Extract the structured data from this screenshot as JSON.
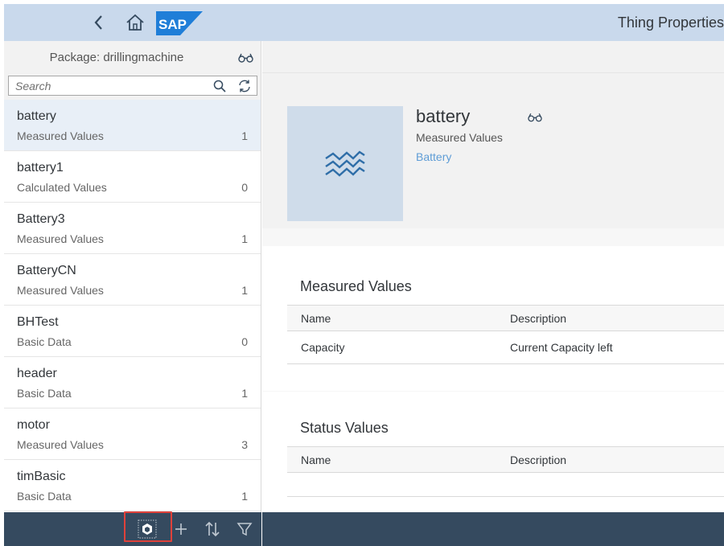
{
  "shell": {
    "title": "Thing Properties",
    "logo_text": "SAP"
  },
  "master": {
    "package_label": "Package: drillingmachine",
    "search_placeholder": "Search",
    "items": [
      {
        "name": "battery",
        "type": "Measured Values",
        "count": "1",
        "selected": true
      },
      {
        "name": "battery1",
        "type": "Calculated Values",
        "count": "0"
      },
      {
        "name": "Battery3",
        "type": "Measured Values",
        "count": "1"
      },
      {
        "name": "BatteryCN",
        "type": "Measured Values",
        "count": "1"
      },
      {
        "name": "BHTest",
        "type": "Basic Data",
        "count": "0"
      },
      {
        "name": "header",
        "type": "Basic Data",
        "count": "1"
      },
      {
        "name": "motor",
        "type": "Measured Values",
        "count": "3"
      },
      {
        "name": "timBasic",
        "type": "Basic Data",
        "count": "1"
      }
    ]
  },
  "detail": {
    "title": "battery",
    "subtitle": "Measured Values",
    "link": "Battery",
    "measured": {
      "title": "Measured Values",
      "columns": [
        "Name",
        "Description"
      ],
      "rows": [
        {
          "name": "Capacity",
          "description": "Current Capacity left"
        }
      ]
    },
    "status": {
      "title": "Status Values",
      "columns": [
        "Name",
        "Description"
      ]
    }
  },
  "colors": {
    "shell": "#c9d9ec",
    "footer": "#354a5f",
    "selected_row": "#e8eff7",
    "link": "#5f9dd6",
    "highlight": "#e0413a",
    "logo": "#1f7ed8"
  }
}
